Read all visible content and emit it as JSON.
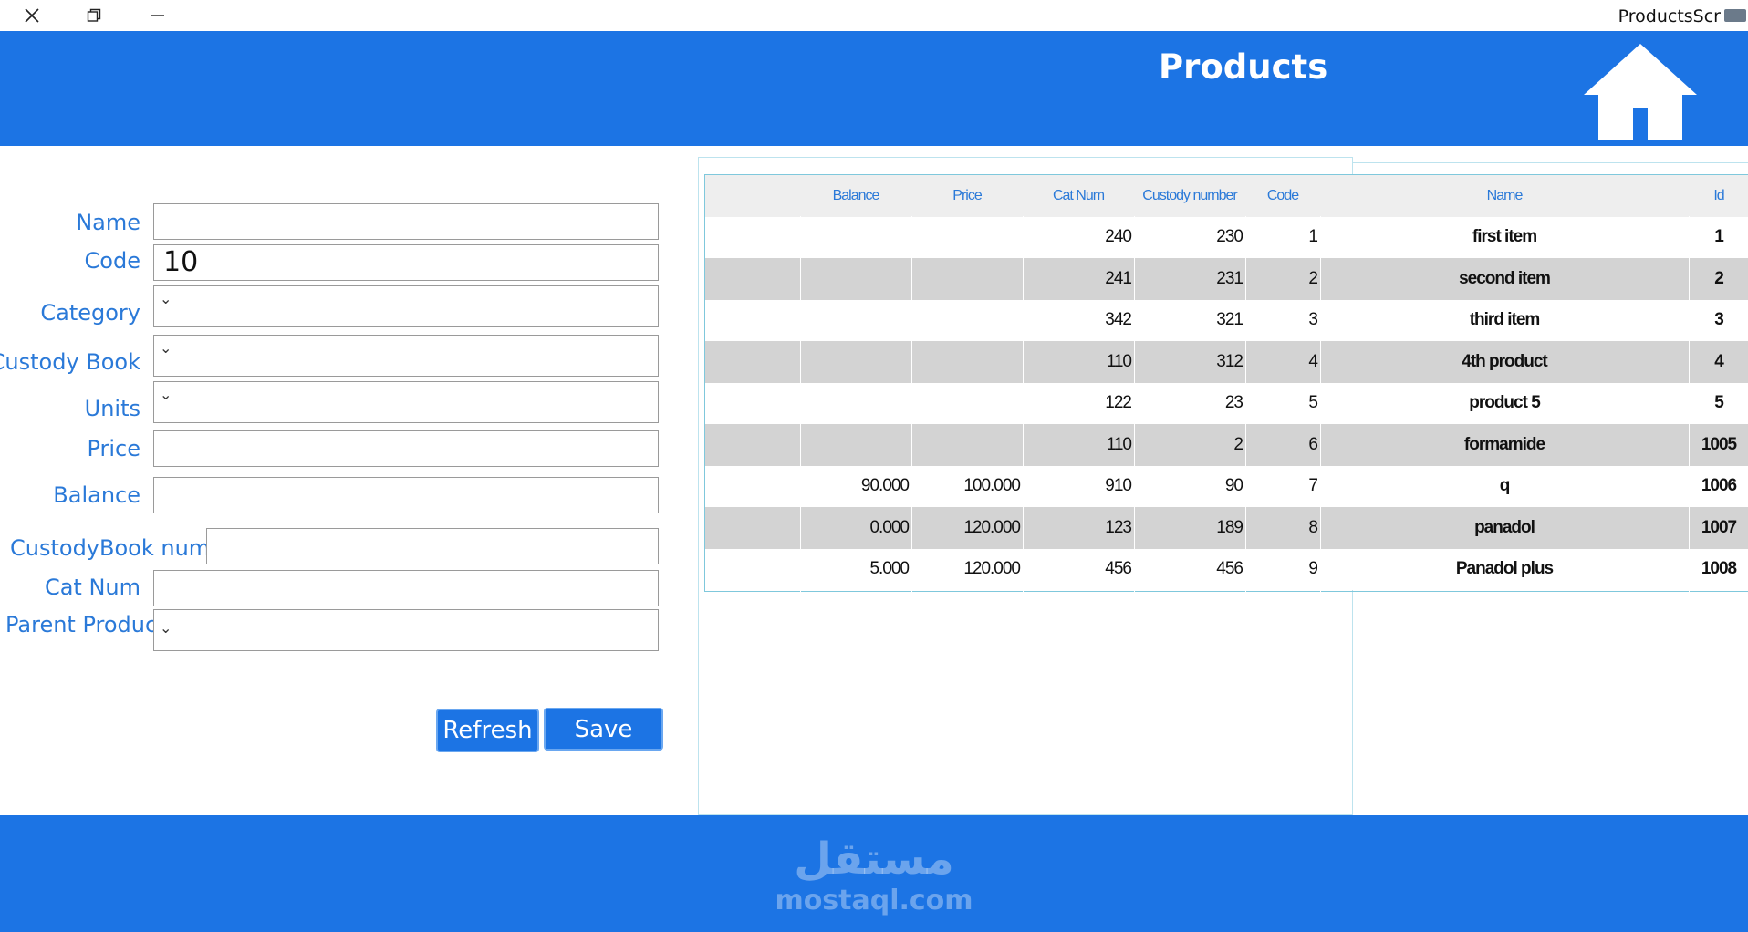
{
  "window": {
    "title": "ProductsScr",
    "close_icon": "close-icon",
    "restore_icon": "restore-icon",
    "minimize_icon": "minimize-icon"
  },
  "header": {
    "title": "Products",
    "home_icon": "home-icon",
    "bg_color": "#1c74e4"
  },
  "form": {
    "name_label": "Name",
    "name_value": "",
    "code_label": "Code",
    "code_value": "10",
    "category_label": "Category",
    "custody_book_label": "Custody Book",
    "units_label": "Units",
    "price_label": "Price",
    "price_value": "",
    "balance_label": "Balance",
    "balance_value": "",
    "custodybook_num_label": "CustodyBook num",
    "custodybook_num_value": "",
    "cat_num_label": "Cat Num",
    "cat_num_value": "",
    "parent_product_label": "Parent Product"
  },
  "buttons": {
    "refresh": "Refresh",
    "save": "Save"
  },
  "grid": {
    "columns": [
      "Balance",
      "Price",
      "Cat Num",
      "Custody number",
      "Code",
      "Name",
      "Id"
    ],
    "rows": [
      {
        "balance": "",
        "price": "",
        "cat_num": "240",
        "custody_number": "230",
        "code": "1",
        "name": "first item",
        "id": "1"
      },
      {
        "balance": "",
        "price": "",
        "cat_num": "241",
        "custody_number": "231",
        "code": "2",
        "name": "second item",
        "id": "2"
      },
      {
        "balance": "",
        "price": "",
        "cat_num": "342",
        "custody_number": "321",
        "code": "3",
        "name": "third item",
        "id": "3"
      },
      {
        "balance": "",
        "price": "",
        "cat_num": "110",
        "custody_number": "312",
        "code": "4",
        "name": "4th product",
        "id": "4"
      },
      {
        "balance": "",
        "price": "",
        "cat_num": "122",
        "custody_number": "23",
        "code": "5",
        "name": "product 5",
        "id": "5"
      },
      {
        "balance": "",
        "price": "",
        "cat_num": "110",
        "custody_number": "2",
        "code": "6",
        "name": "formamide",
        "id": "1005"
      },
      {
        "balance": "90.000",
        "price": "100.000",
        "cat_num": "910",
        "custody_number": "90",
        "code": "7",
        "name": "q",
        "id": "1006"
      },
      {
        "balance": "0.000",
        "price": "120.000",
        "cat_num": "123",
        "custody_number": "189",
        "code": "8",
        "name": "panadol",
        "id": "1007"
      },
      {
        "balance": "5.000",
        "price": "120.000",
        "cat_num": "456",
        "custody_number": "456",
        "code": "9",
        "name": "Panadol plus",
        "id": "1008"
      }
    ]
  },
  "footer": {
    "watermark_ar": "مستقل",
    "watermark_en": "mostaql.com"
  }
}
